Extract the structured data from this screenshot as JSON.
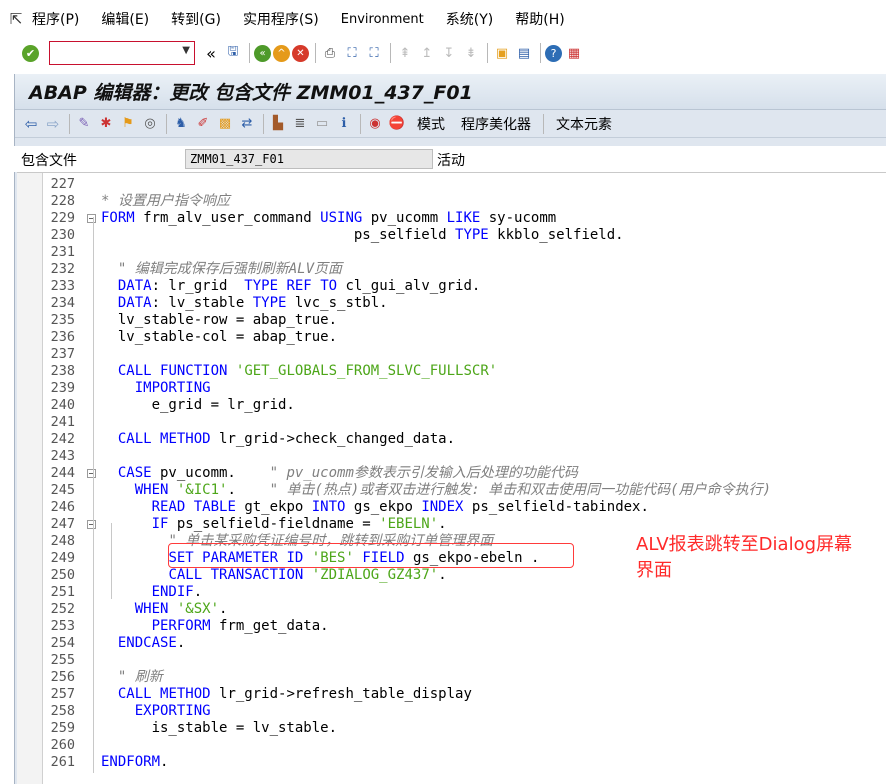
{
  "menu": {
    "items": [
      "程序(P)",
      "编辑(E)",
      "转到(G)",
      "实用程序(S)",
      "Environment",
      "系统(Y)",
      "帮助(H)"
    ]
  },
  "title": "ABAP 编辑器：更改 包含文件 ZMM01_437_F01",
  "app_toolbar": {
    "mode_label": "模式",
    "pretty_printer_label": "程序美化器",
    "text_elements_label": "文本元素"
  },
  "include_row": {
    "label": "包含文件",
    "value": "ZMM01_437_F01",
    "status": "活动"
  },
  "annotation": "ALV报表跳转至Dialog屏幕界面",
  "colors": {
    "keyword": "#0000ff",
    "string": "#4da619",
    "comment": "#808080",
    "highlight": "#ff3b3b"
  },
  "code_lines": [
    {
      "num": "227",
      "code": ""
    },
    {
      "num": "228",
      "code": "* 设置用户指令响应"
    },
    {
      "num": "229",
      "code": "FORM frm_alv_user_command USING pv_ucomm LIKE sy-ucomm"
    },
    {
      "num": "230",
      "code": "                              ps_selfield TYPE kkblo_selfield."
    },
    {
      "num": "231",
      "code": ""
    },
    {
      "num": "232",
      "code": "  \" 编辑完成保存后强制刷新ALV页面"
    },
    {
      "num": "233",
      "code": "  DATA: lr_grid  TYPE REF TO cl_gui_alv_grid."
    },
    {
      "num": "234",
      "code": "  DATA: lv_stable TYPE lvc_s_stbl."
    },
    {
      "num": "235",
      "code": "  lv_stable-row = abap_true."
    },
    {
      "num": "236",
      "code": "  lv_stable-col = abap_true."
    },
    {
      "num": "237",
      "code": ""
    },
    {
      "num": "238",
      "code": "  CALL FUNCTION 'GET_GLOBALS_FROM_SLVC_FULLSCR'"
    },
    {
      "num": "239",
      "code": "    IMPORTING"
    },
    {
      "num": "240",
      "code": "      e_grid = lr_grid."
    },
    {
      "num": "241",
      "code": ""
    },
    {
      "num": "242",
      "code": "  CALL METHOD lr_grid->check_changed_data."
    },
    {
      "num": "243",
      "code": ""
    },
    {
      "num": "244",
      "code": "  CASE pv_ucomm.    \" pv_ucomm参数表示引发输入后处理的功能代码"
    },
    {
      "num": "245",
      "code": "    WHEN '&IC1'.    \" 单击(热点)或者双击进行触发: 单击和双击使用同一功能代码(用户命令执行)"
    },
    {
      "num": "246",
      "code": "      READ TABLE gt_ekpo INTO gs_ekpo INDEX ps_selfield-tabindex."
    },
    {
      "num": "247",
      "code": "      IF ps_selfield-fieldname = 'EBELN'."
    },
    {
      "num": "248",
      "code": "        \" 单击某采购凭证编号时，跳转到采购订单管理界面"
    },
    {
      "num": "249",
      "code": "        SET PARAMETER ID 'BES' FIELD gs_ekpo-ebeln ."
    },
    {
      "num": "250",
      "code": "        CALL TRANSACTION 'ZDIALOG_GZ437'."
    },
    {
      "num": "251",
      "code": "      ENDIF."
    },
    {
      "num": "252",
      "code": "    WHEN '&SX'."
    },
    {
      "num": "253",
      "code": "      PERFORM frm_get_data."
    },
    {
      "num": "254",
      "code": "  ENDCASE."
    },
    {
      "num": "255",
      "code": ""
    },
    {
      "num": "256",
      "code": "  \" 刷新"
    },
    {
      "num": "257",
      "code": "  CALL METHOD lr_grid->refresh_table_display"
    },
    {
      "num": "258",
      "code": "    EXPORTING"
    },
    {
      "num": "259",
      "code": "      is_stable = lv_stable."
    },
    {
      "num": "260",
      "code": ""
    },
    {
      "num": "261",
      "code": "ENDFORM."
    }
  ],
  "icons": {
    "menu": "system-menu-icon",
    "toolbar": [
      "enter-icon",
      "save-icon",
      "back-icon",
      "exit-icon",
      "cancel-icon",
      "print-icon",
      "find-icon",
      "find-next-icon",
      "first-page-icon",
      "prev-page-icon",
      "next-page-icon",
      "last-page-icon",
      "create-session-icon",
      "shortcut-icon",
      "help-icon",
      "customize-layout-icon"
    ]
  }
}
